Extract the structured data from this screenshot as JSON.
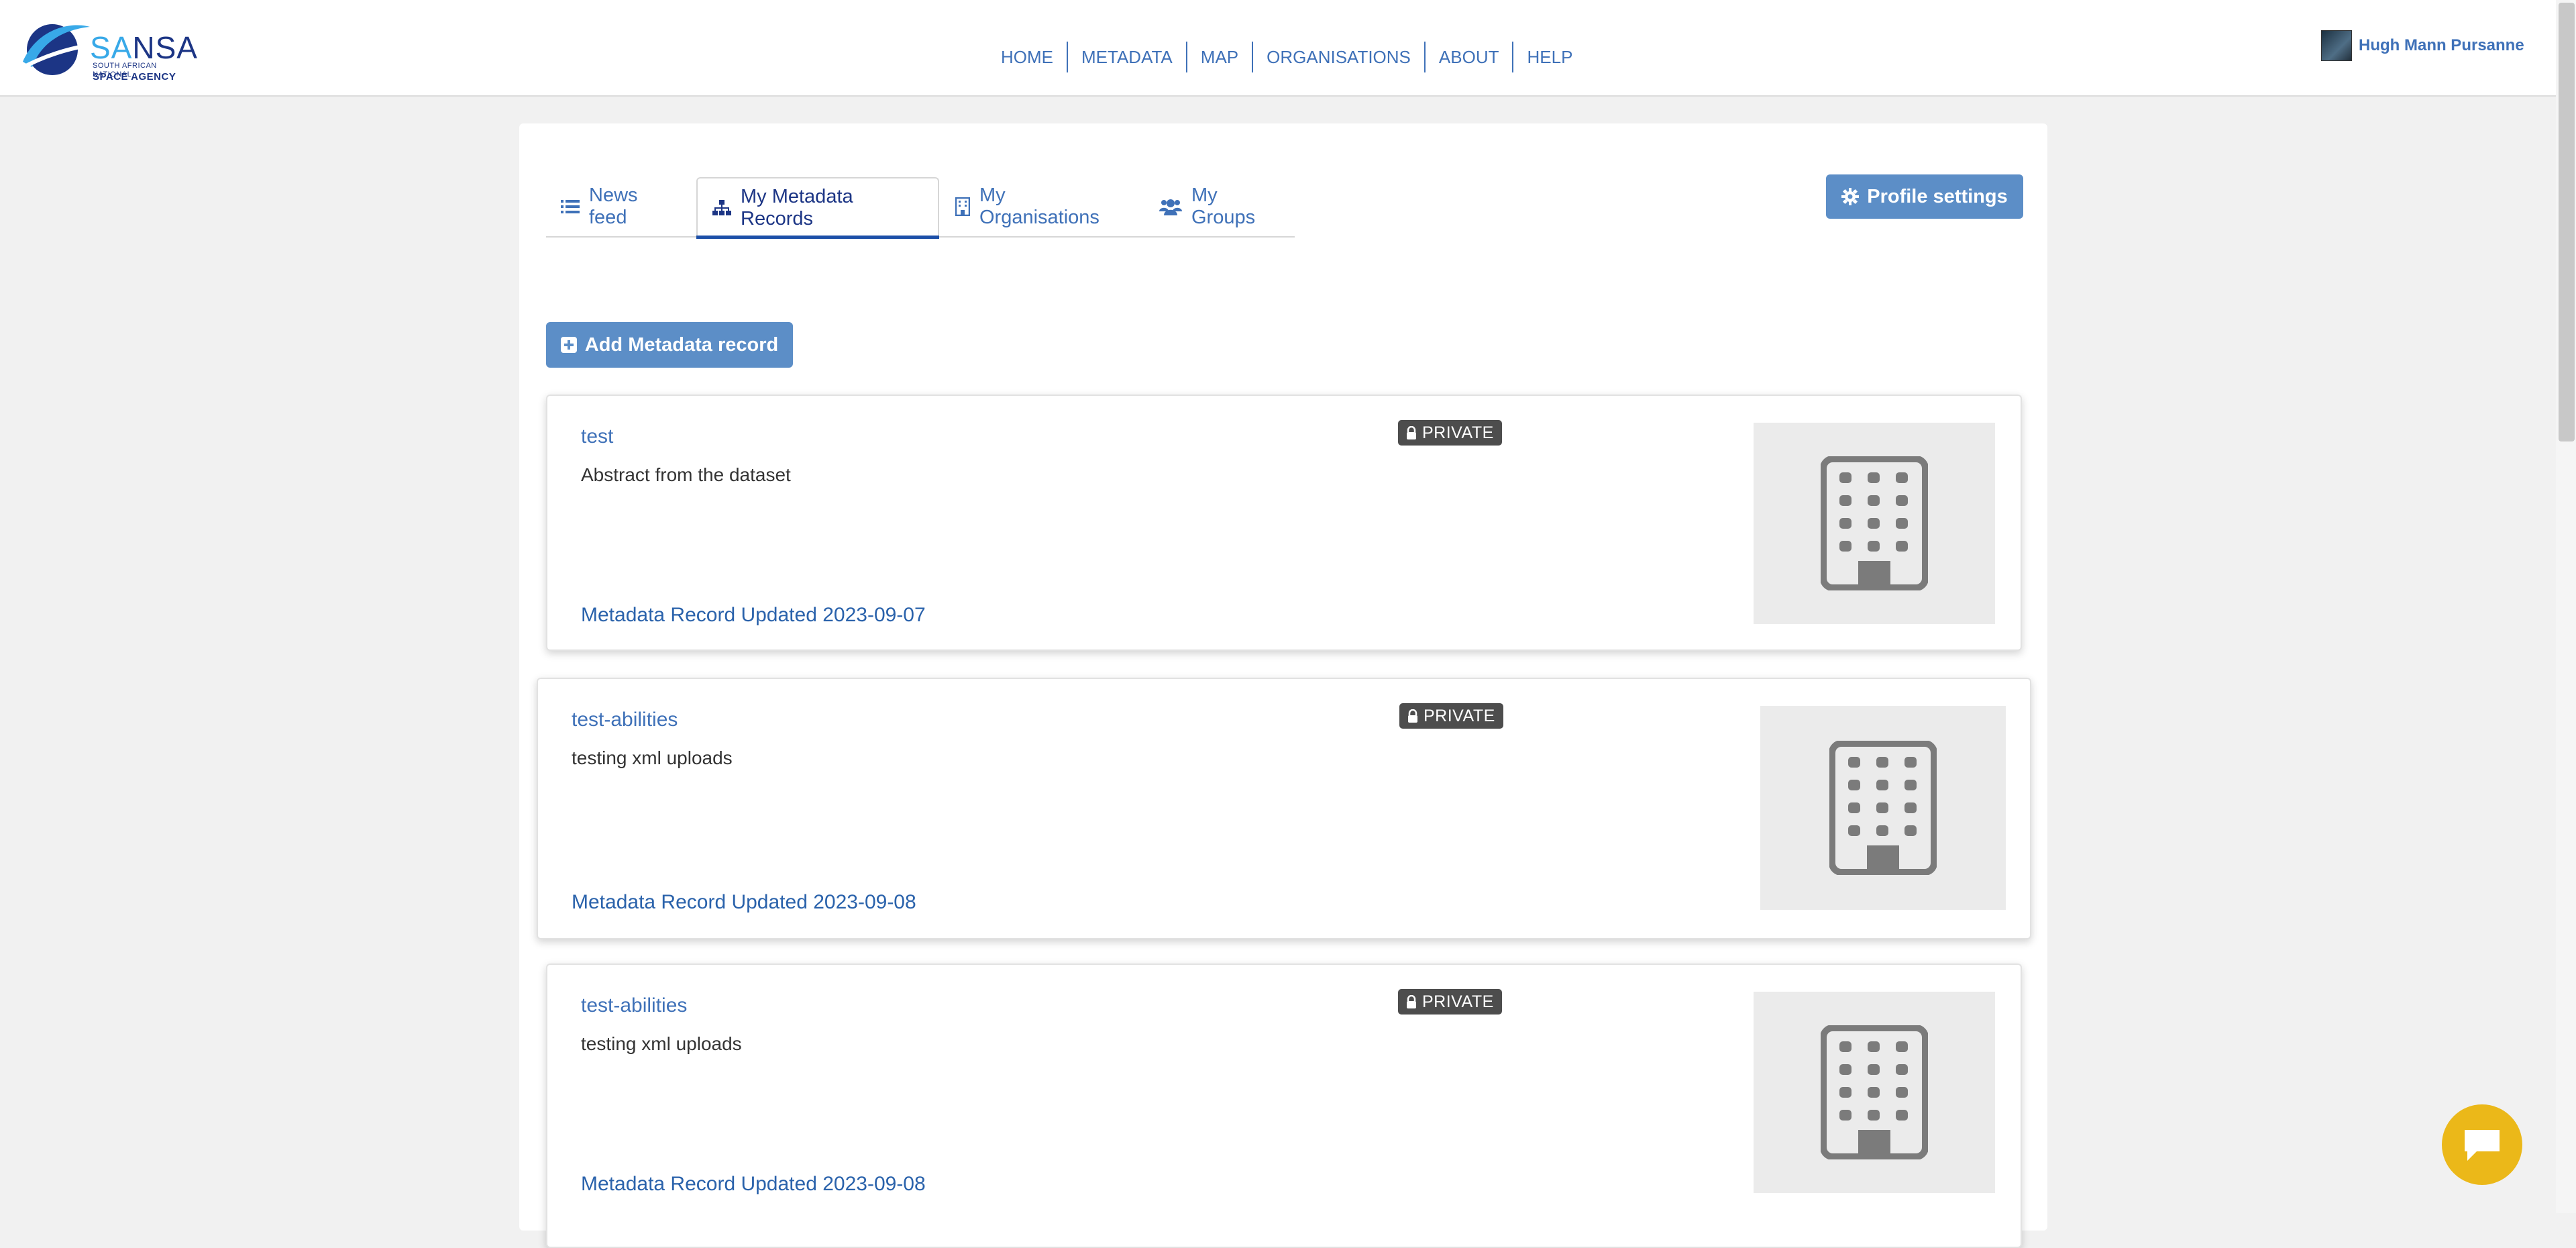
{
  "header": {
    "logo": {
      "word_part1": "SA",
      "word_part2": "NSA",
      "subtitle": "SOUTH AFRICAN NATIONAL",
      "subtitle2": "SPACE AGENCY"
    },
    "nav": [
      "HOME",
      "METADATA",
      "MAP",
      "ORGANISATIONS",
      "ABOUT",
      "HELP"
    ],
    "user": {
      "name": "Hugh Mann Pursanne"
    }
  },
  "tabs": [
    {
      "label": "News feed",
      "icon": "list-icon",
      "active": false
    },
    {
      "label": "My Metadata Records",
      "icon": "sitemap-icon",
      "active": true
    },
    {
      "label": "My Organisations",
      "icon": "building-icon",
      "active": false
    },
    {
      "label": "My Groups",
      "icon": "users-icon",
      "active": false
    }
  ],
  "buttons": {
    "profile_settings": "Profile settings",
    "add_record": "Add Metadata record"
  },
  "records": [
    {
      "title": "test",
      "abstract": "Abstract from the dataset",
      "badge": "PRIVATE",
      "updated": "Metadata Record Updated 2023-09-07"
    },
    {
      "title": "test-abilities",
      "abstract": "testing xml uploads",
      "badge": "PRIVATE",
      "updated": "Metadata Record Updated 2023-09-08"
    },
    {
      "title": "test-abilities",
      "abstract": "testing xml uploads",
      "badge": "PRIVATE",
      "updated": "Metadata Record Updated 2023-09-08"
    }
  ],
  "colors": {
    "brand_blue": "#3f71b8",
    "button_blue": "#5c8ec7",
    "badge_gray": "#4d4d4d",
    "chat_yellow": "#ebb819"
  },
  "icons": {
    "record_thumb": "building-icon",
    "badge": "lock-icon",
    "chat": "chat-bubble-icon",
    "profile": "gear-icon",
    "add": "plus-square-icon"
  }
}
